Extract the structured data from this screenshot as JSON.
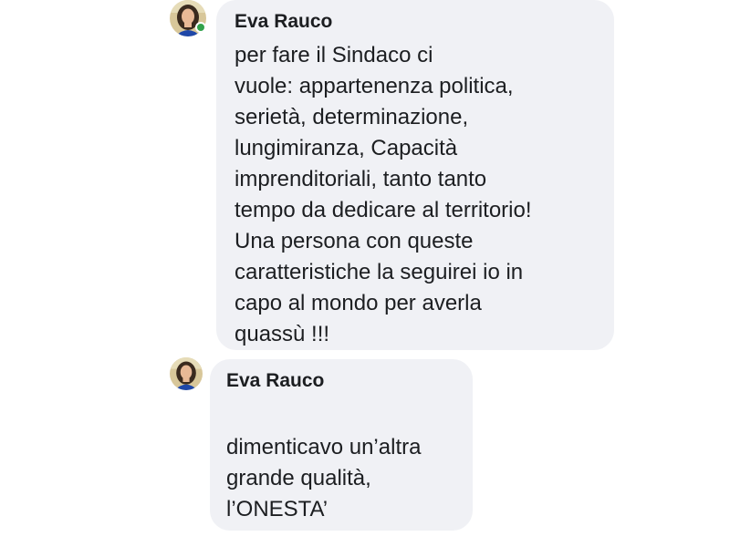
{
  "messages": [
    {
      "author": "Eva Rauco",
      "text": "                    per fare il Sindaco ci\nvuole: appartenenza politica,\nserietà, determinazione,\nlungimiranza, Capacità\nimprenditoriali, tanto tanto\ntempo da dedicare al territorio!\nUna persona con queste\ncaratteristiche la seguirei io in\ncapo al mondo per averla\nquassù !!!",
      "online": true
    },
    {
      "author": "Eva Rauco",
      "text": "dimenticavo un’altra\ngrande qualità,\nl’ONESTA’",
      "online": false
    }
  ],
  "colors": {
    "bubble_bg": "#f0f1f5",
    "text": "#1c1e21",
    "online_dot": "#31a24c"
  },
  "icons": {
    "avatar": "user-avatar-photo",
    "presence": "online-status-dot"
  }
}
